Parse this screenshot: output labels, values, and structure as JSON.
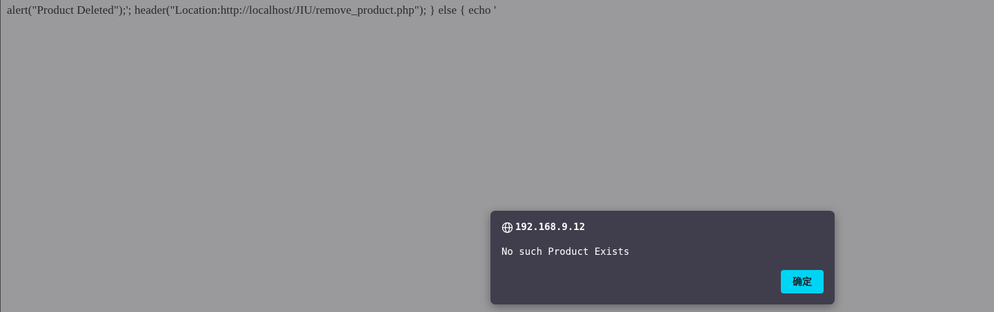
{
  "page": {
    "text": "alert(\"Product Deleted\");'; header(\"Location:http://localhost/JIU/remove_product.php\"); } else { echo '"
  },
  "dialog": {
    "origin": "192.168.9.12",
    "origin_icon": "globe-icon",
    "message": "No such Product Exists",
    "ok_label": "确定",
    "ok_color": "#00d4f5",
    "background_color": "#403e4c"
  }
}
